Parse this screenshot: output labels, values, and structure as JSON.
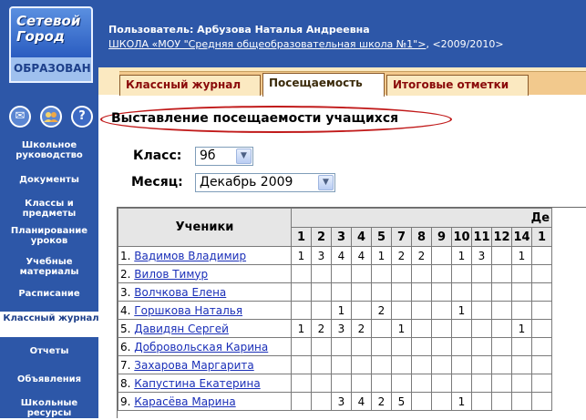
{
  "logo": {
    "line1": "Сетевой",
    "line2": "Город",
    "line3": "ОБРАЗОВАНИЕ"
  },
  "side_icons": [
    {
      "name": "mail-icon",
      "glyph": "✉"
    },
    {
      "name": "users-icon",
      "glyph": "👥"
    },
    {
      "name": "help-icon",
      "glyph": "?"
    }
  ],
  "sidebar": {
    "items": [
      {
        "label": "Школьное руководство"
      },
      {
        "label": "Документы"
      },
      {
        "label": "Классы и предметы"
      },
      {
        "label": "Планирование уроков"
      },
      {
        "label": "Учебные материалы"
      },
      {
        "label": "Расписание"
      },
      {
        "label": "Классный журнал",
        "active": true
      },
      {
        "label": "Отчеты"
      },
      {
        "label": "Объявления"
      },
      {
        "label": "Школьные ресурсы"
      }
    ]
  },
  "header": {
    "user": "Пользователь: Арбузова Наталья Андреевна",
    "school_link": "ШКОЛА «МОУ \"Средняя общеобразовательная школа №1\">",
    "year": ", <2009/2010>"
  },
  "tabs": [
    {
      "label": "Классный журнал"
    },
    {
      "label": "Посещаемость",
      "active": true
    },
    {
      "label": "Итоговые отметки"
    }
  ],
  "page_title": "Выставление посещаемости учащихся",
  "filters": {
    "class_label": "Класс:",
    "class_value": "9б",
    "month_label": "Месяц:",
    "month_value": "Декабрь 2009"
  },
  "table": {
    "students_header": "Ученики",
    "month_header": "Де",
    "days": [
      "1",
      "2",
      "3",
      "4",
      "5",
      "7",
      "8",
      "9",
      "10",
      "11",
      "12",
      "14",
      "1"
    ],
    "rows": [
      {
        "num": "1.",
        "name": "Вадимов Владимир",
        "marks": [
          "1",
          "3",
          "4",
          "4",
          "1",
          "2",
          "2",
          "",
          "1",
          "3",
          "",
          "1",
          ""
        ]
      },
      {
        "num": "2.",
        "name": "Вилов Тимур",
        "marks": [
          "",
          "",
          "",
          "",
          "",
          "",
          "",
          "",
          "",
          "",
          "",
          "",
          ""
        ]
      },
      {
        "num": "3.",
        "name": "Волчкова Елена",
        "marks": [
          "",
          "",
          "",
          "",
          "",
          "",
          "",
          "",
          "",
          "",
          "",
          "",
          ""
        ]
      },
      {
        "num": "4.",
        "name": "Горшкова Наталья",
        "marks": [
          "",
          "",
          "1",
          "",
          "2",
          "",
          "",
          "",
          "1",
          "",
          "",
          "",
          ""
        ]
      },
      {
        "num": "5.",
        "name": "Давидян Сергей",
        "marks": [
          "1",
          "2",
          "3",
          "2",
          "",
          "1",
          "",
          "",
          "",
          "",
          "",
          "1",
          ""
        ]
      },
      {
        "num": "6.",
        "name": "Добровольская Карина",
        "marks": [
          "",
          "",
          "",
          "",
          "",
          "",
          "",
          "",
          "",
          "",
          "",
          "",
          ""
        ]
      },
      {
        "num": "7.",
        "name": "Захарова Маргарита",
        "marks": [
          "",
          "",
          "",
          "",
          "",
          "",
          "",
          "",
          "",
          "",
          "",
          "",
          ""
        ]
      },
      {
        "num": "8.",
        "name": "Капустина Екатерина",
        "marks": [
          "",
          "",
          "",
          "",
          "",
          "",
          "",
          "",
          "",
          "",
          "",
          "",
          ""
        ]
      },
      {
        "num": "9.",
        "name": "Карасёва Марина",
        "marks": [
          "",
          "",
          "3",
          "4",
          "2",
          "5",
          "",
          "",
          "1",
          "",
          "",
          "",
          ""
        ]
      }
    ]
  }
}
